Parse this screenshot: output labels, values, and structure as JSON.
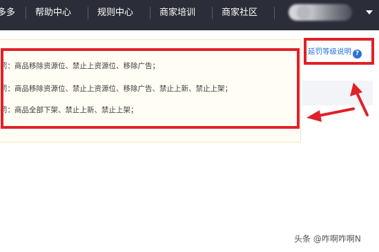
{
  "topnav": {
    "items": [
      {
        "label": "多多"
      },
      {
        "label": "帮助中心"
      },
      {
        "label": "规则中心"
      },
      {
        "label": "商家培训"
      },
      {
        "label": "商家社区"
      }
    ]
  },
  "notice": {
    "lines": [
      "罚：商品移除资源位、禁止上资源位、移除广告；",
      "罚：商品移除资源位、禁止上资源位、移除广告、禁止上新、禁止上架；",
      "罚：商品全部下架、禁止上新、禁止上架；"
    ]
  },
  "help_link": {
    "label": "延罚等级说明",
    "icon": "?"
  },
  "watermark": "头条 @咋啊咋啊N",
  "colors": {
    "nav_bg": "#2b2e38",
    "annotation_red": "#e02028",
    "link_blue": "#2a6fd6",
    "notice_bg": "#fffdf4"
  },
  "icons": [
    "help-circle-icon",
    "chevron-down-icon",
    "avatar"
  ]
}
